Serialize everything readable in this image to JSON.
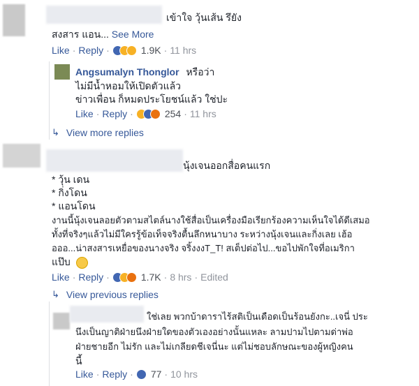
{
  "comments": [
    {
      "text_lines": [
        "เข้าใจ วุ้นเส้น รึยัง",
        "สงสาร แอน..."
      ],
      "see_more": "See More",
      "actions": {
        "like": "Like",
        "reply": "Reply",
        "count": "1.9K",
        "time": "11 hrs"
      },
      "reaction_icons": [
        "like-icon",
        "haha-icon",
        "wow-icon"
      ],
      "replies": [
        {
          "author": "Angsumalyn Thonglor",
          "text_lines": [
            "หรือว่า",
            "ไม่มีน้ำหอมให้เปิดตัวแล้ว",
            "ข่าวเพื่อน ก็หมดประโยชน์แล้ว ใช่ปะ"
          ],
          "actions": {
            "like": "Like",
            "reply": "Reply",
            "count": "254",
            "time": "11 hrs"
          },
          "reaction_icons": [
            "haha-icon",
            "like-icon",
            "angry-icon"
          ]
        }
      ],
      "more_replies": "View more replies"
    },
    {
      "text_lines": [
        "นุ้งเจนออกสื่อคนแรก",
        "* วุ้น เดน",
        "* กิ่งโดน",
        "* แอนโดน",
        "งานนี้นุ้งเจนลอยตัวตามสไตล์นางใช้สื่อเป็นเครื่องมือเรียกร้องความเห็นใจได้ดีเสมอ",
        "ทั้งที่จริงๆแล้วไม่มีใครรู้ข้อเท็จจริงตื้นลึกหนาบาง ระหว่างนุ้งเจนและกิ่งเลย เฮ้อ",
        "อออ...น่าสงสารเหยื่อของนางจริง จริ้งงงT_T! สเต็ปต่อไป...ขอไปพักใจที่อเมริกา",
        "แป๊บ"
      ],
      "actions": {
        "like": "Like",
        "reply": "Reply",
        "count": "1.7K",
        "time": "8 hrs",
        "edited": "Edited"
      },
      "reaction_icons": [
        "like-icon",
        "haha-icon",
        "angry-icon"
      ],
      "previous_replies": "View previous replies",
      "replies": [
        {
          "text_lines": [
            "ใช่เลย พวกบ้าดาราไร้สติเป็นเดือดเป็นร้อนยังกะ..เจนี่ ประ",
            "นึงเป็นญาติฝ่ายนึงฝ่ายใดของตัวเองอย่างนั้นแหละ ลามปามไปตามด่าพ่อ",
            "ฝ่ายชายอีก ไม่รัก และไม่เกลียดชีเจนี่นะ แต่ไม่ชอบลักษณะของผู้หญิงคน",
            "นี้"
          ],
          "actions": {
            "like": "Like",
            "reply": "Reply",
            "count": "77",
            "time": "10 hrs"
          },
          "reaction_icons": [
            "like-icon"
          ]
        }
      ]
    }
  ]
}
